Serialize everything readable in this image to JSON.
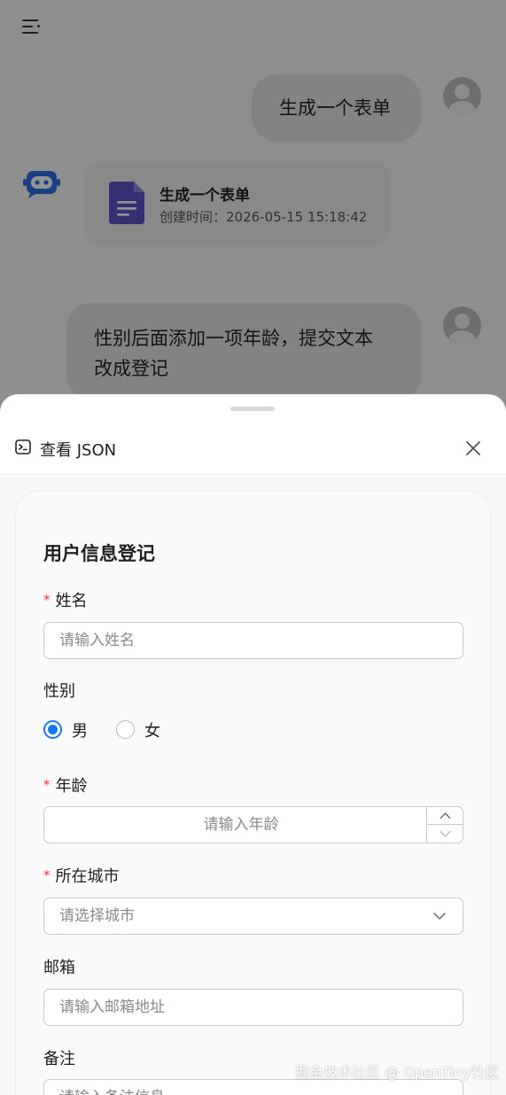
{
  "chat": {
    "messages": [
      {
        "role": "user",
        "text": "生成一个表单"
      },
      {
        "role": "assistant",
        "card_title": "生成一个表单",
        "card_time": "创建时间：2026-05-15 15:18:42"
      },
      {
        "role": "user",
        "text_line1": "性别后面添加一项年龄，提交文本",
        "text_line2": "改成登记"
      }
    ]
  },
  "sheet": {
    "title": "查看 JSON",
    "form": {
      "title": "用户信息登记",
      "required_mark": "*",
      "name": {
        "label": "姓名",
        "placeholder": "请输入姓名",
        "required": true
      },
      "gender": {
        "label": "性别",
        "options": [
          "男",
          "女"
        ],
        "selected": "男"
      },
      "age": {
        "label": "年龄",
        "placeholder": "请输入年龄",
        "required": true
      },
      "city": {
        "label": "所在城市",
        "placeholder": "请选择城市",
        "required": true
      },
      "email": {
        "label": "邮箱",
        "placeholder": "请输入邮箱地址"
      },
      "remark": {
        "label": "备注",
        "placeholder": "请输入备注信息"
      }
    }
  },
  "colors": {
    "accent": "#1476ff",
    "required": "#f23030",
    "doc_icon": "#5b53c6",
    "bot_icon": "#2f6fe0"
  },
  "watermark": "掘金技术社区 @ OpenTiny社区"
}
